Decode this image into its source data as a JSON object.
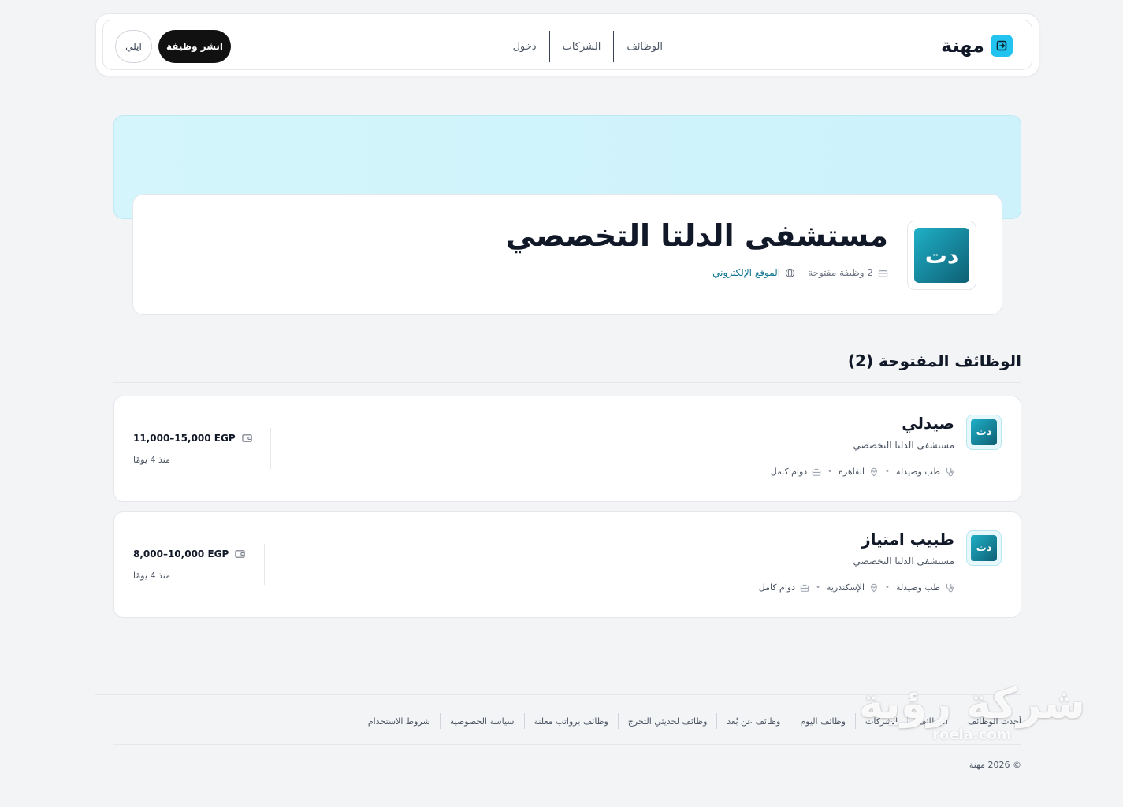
{
  "header": {
    "brand_name": "مهنة",
    "nav": [
      {
        "label": "الوظائف"
      },
      {
        "label": "الشركات"
      },
      {
        "label": "دخول"
      }
    ],
    "post_job_label": "انشر وظيفة",
    "user_label": "ايلي"
  },
  "company": {
    "logo_text": "دت",
    "name": "مستشفى الدلتا التخصصي",
    "open_jobs": "2 وظيفة مفتوحة",
    "website_label": "الموقع الإلكتروني"
  },
  "jobs_section": {
    "title": "الوظائف المفتوحة (2)"
  },
  "jobs": [
    {
      "logo_text": "دت",
      "title": "صيدلي",
      "company": "مستشفى الدلتا التخصصي",
      "category": "طب وصيدلة",
      "location": "القاهرة",
      "type": "دوام كامل",
      "salary": "11,000–15,000 EGP",
      "posted": "منذ 4 يومًا"
    },
    {
      "logo_text": "دت",
      "title": "طبيب امتياز",
      "company": "مستشفى الدلتا التخصصي",
      "category": "طب وصيدلة",
      "location": "الإسكندرية",
      "type": "دوام كامل",
      "salary": "8,000–10,000 EGP",
      "posted": "منذ 4 يومًا"
    }
  ],
  "footer": {
    "links": [
      {
        "label": "أحدث الوظائف"
      },
      {
        "label": "الوظائف"
      },
      {
        "label": "الشركات"
      },
      {
        "label": "وظائف اليوم"
      },
      {
        "label": "وظائف عن بُعد"
      },
      {
        "label": "وظائف لحديثي التخرج"
      },
      {
        "label": "وظائف برواتب معلنة"
      },
      {
        "label": "سياسة الخصوصية"
      },
      {
        "label": "شروط الاستخدام"
      }
    ],
    "copyright": "© 2026 مهنة"
  },
  "watermark": {
    "arabic": "شركة رؤية",
    "domain": "roeia.com"
  },
  "colors": {
    "accent": "#22c3ee",
    "logo_gradient_start": "#1fb0c7",
    "logo_gradient_end": "#0e5f74",
    "banner": "#d3f5fb",
    "link": "#0e7490",
    "primary_button": "#111111"
  }
}
